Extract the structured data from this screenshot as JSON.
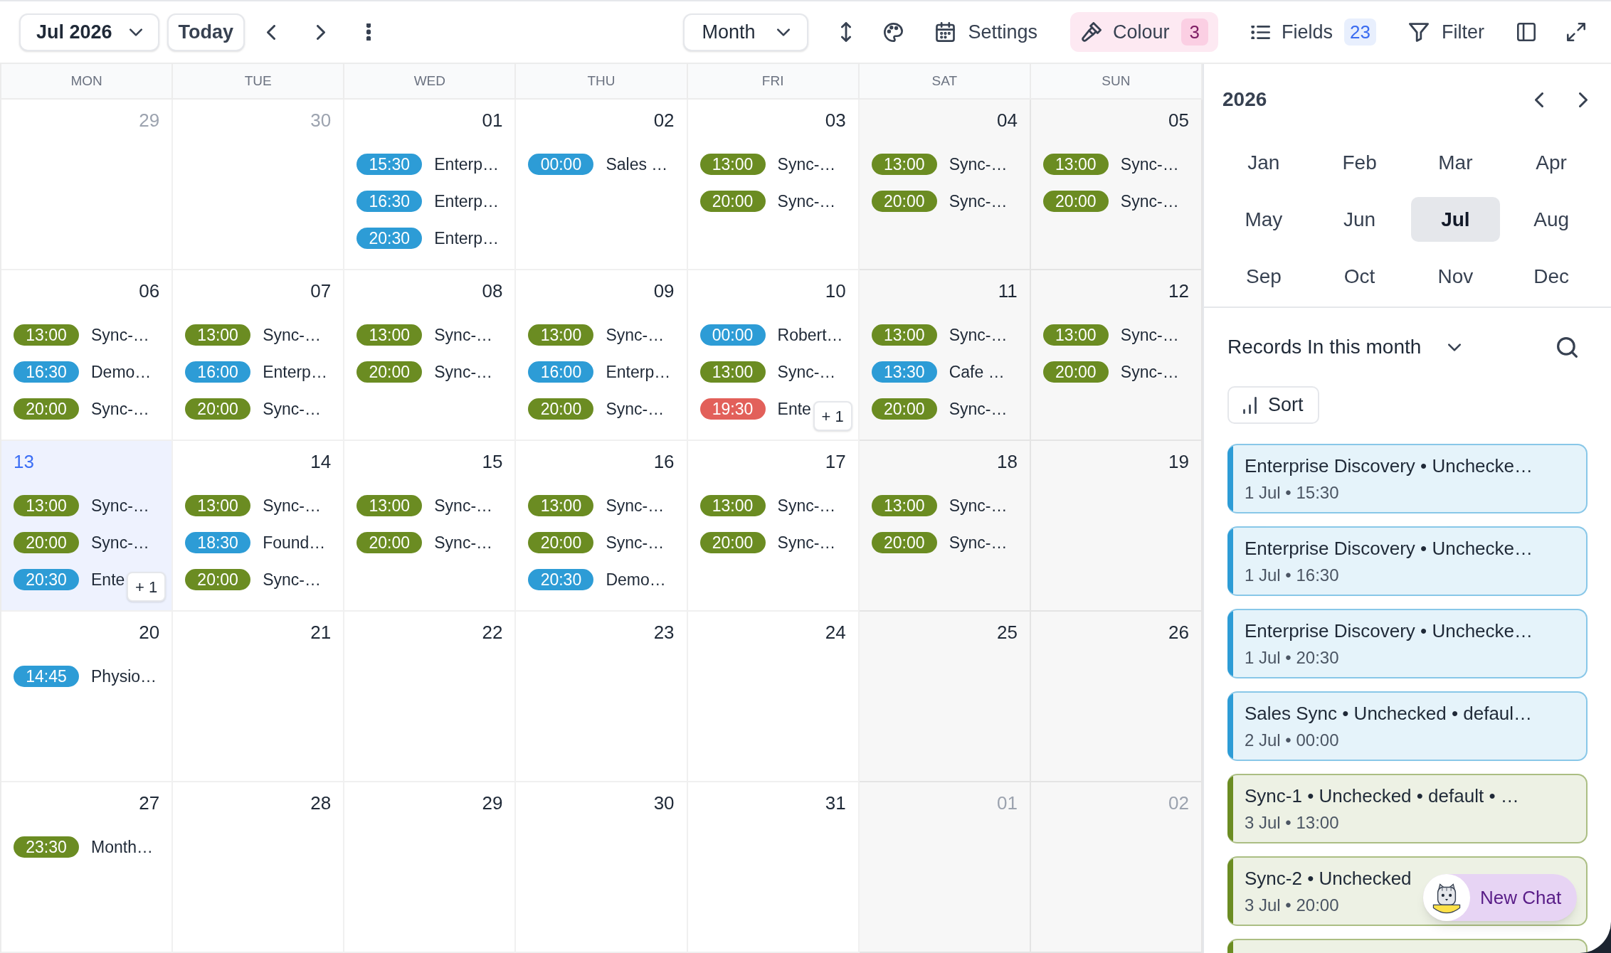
{
  "toolbar": {
    "period_picker": "Jul 2026",
    "today_button": "Today",
    "view_picker": "Month",
    "settings_button": "Settings",
    "colour_button": {
      "label": "Colour",
      "count": "3"
    },
    "fields_button": {
      "label": "Fields",
      "count": "23"
    },
    "filter_button": "Filter"
  },
  "calendar": {
    "weekdays": [
      {
        "label": "MON",
        "weekend": false
      },
      {
        "label": "TUE",
        "weekend": false
      },
      {
        "label": "WED",
        "weekend": false
      },
      {
        "label": "THU",
        "weekend": false
      },
      {
        "label": "FRI",
        "weekend": false
      },
      {
        "label": "SAT",
        "weekend": true
      },
      {
        "label": "SUN",
        "weekend": true
      }
    ],
    "weeks": [
      [
        {
          "day": "29",
          "outside_month": true,
          "today": false
        },
        {
          "day": "30",
          "outside_month": true,
          "today": false
        },
        {
          "day": "01",
          "outside_month": false,
          "today": false,
          "events": [
            {
              "time": "15:30",
              "title": "Enterp…",
              "color": "#2d9cd6"
            },
            {
              "time": "16:30",
              "title": "Enterp…",
              "color": "#2d9cd6"
            },
            {
              "time": "20:30",
              "title": "Enterp…",
              "color": "#2d9cd6"
            }
          ]
        },
        {
          "day": "02",
          "outside_month": false,
          "today": false,
          "events": [
            {
              "time": "00:00",
              "title": "Sales …",
              "color": "#2d9cd6"
            }
          ]
        },
        {
          "day": "03",
          "outside_month": false,
          "today": false,
          "events": [
            {
              "time": "13:00",
              "title": "Sync-…",
              "color": "#6b8c22"
            },
            {
              "time": "20:00",
              "title": "Sync-…",
              "color": "#6b8c22"
            }
          ]
        },
        {
          "day": "04",
          "outside_month": false,
          "today": false,
          "events": [
            {
              "time": "13:00",
              "title": "Sync-…",
              "color": "#6b8c22"
            },
            {
              "time": "20:00",
              "title": "Sync-…",
              "color": "#6b8c22"
            }
          ]
        },
        {
          "day": "05",
          "outside_month": false,
          "today": false,
          "events": [
            {
              "time": "13:00",
              "title": "Sync-…",
              "color": "#6b8c22"
            },
            {
              "time": "20:00",
              "title": "Sync-…",
              "color": "#6b8c22"
            }
          ]
        }
      ],
      [
        {
          "day": "06",
          "outside_month": false,
          "today": false,
          "events": [
            {
              "time": "13:00",
              "title": "Sync-…",
              "color": "#6b8c22"
            },
            {
              "time": "16:30",
              "title": "Demo…",
              "color": "#2d9cd6"
            },
            {
              "time": "20:00",
              "title": "Sync-…",
              "color": "#6b8c22"
            }
          ]
        },
        {
          "day": "07",
          "outside_month": false,
          "today": false,
          "events": [
            {
              "time": "13:00",
              "title": "Sync-…",
              "color": "#6b8c22"
            },
            {
              "time": "16:00",
              "title": "Enterp…",
              "color": "#2d9cd6"
            },
            {
              "time": "20:00",
              "title": "Sync-…",
              "color": "#6b8c22"
            }
          ]
        },
        {
          "day": "08",
          "outside_month": false,
          "today": false,
          "events": [
            {
              "time": "13:00",
              "title": "Sync-…",
              "color": "#6b8c22"
            },
            {
              "time": "20:00",
              "title": "Sync-…",
              "color": "#6b8c22"
            }
          ]
        },
        {
          "day": "09",
          "outside_month": false,
          "today": false,
          "events": [
            {
              "time": "13:00",
              "title": "Sync-…",
              "color": "#6b8c22"
            },
            {
              "time": "16:00",
              "title": "Enterp…",
              "color": "#2d9cd6"
            },
            {
              "time": "20:00",
              "title": "Sync-…",
              "color": "#6b8c22"
            }
          ]
        },
        {
          "day": "10",
          "outside_month": false,
          "today": false,
          "events": [
            {
              "time": "00:00",
              "title": "Robert…",
              "color": "#2d9cd6"
            },
            {
              "time": "13:00",
              "title": "Sync-…",
              "color": "#6b8c22"
            },
            {
              "time": "19:30",
              "title": "Ente",
              "color": "#e2605a"
            }
          ],
          "more": "+ 1"
        },
        {
          "day": "11",
          "outside_month": false,
          "today": false,
          "events": [
            {
              "time": "13:00",
              "title": "Sync-…",
              "color": "#6b8c22"
            },
            {
              "time": "13:30",
              "title": "Cafe …",
              "color": "#2d9cd6"
            },
            {
              "time": "20:00",
              "title": "Sync-…",
              "color": "#6b8c22"
            }
          ]
        },
        {
          "day": "12",
          "outside_month": false,
          "today": false,
          "events": [
            {
              "time": "13:00",
              "title": "Sync-…",
              "color": "#6b8c22"
            },
            {
              "time": "20:00",
              "title": "Sync-…",
              "color": "#6b8c22"
            }
          ]
        }
      ],
      [
        {
          "day": "13",
          "outside_month": false,
          "today": true,
          "events": [
            {
              "time": "13:00",
              "title": "Sync-…",
              "color": "#6b8c22"
            },
            {
              "time": "20:00",
              "title": "Sync-…",
              "color": "#6b8c22"
            },
            {
              "time": "20:30",
              "title": "Ente",
              "color": "#2d9cd6"
            }
          ],
          "more": "+ 1"
        },
        {
          "day": "14",
          "outside_month": false,
          "today": false,
          "events": [
            {
              "time": "13:00",
              "title": "Sync-…",
              "color": "#6b8c22"
            },
            {
              "time": "18:30",
              "title": "Found…",
              "color": "#2d9cd6"
            },
            {
              "time": "20:00",
              "title": "Sync-…",
              "color": "#6b8c22"
            }
          ]
        },
        {
          "day": "15",
          "outside_month": false,
          "today": false,
          "events": [
            {
              "time": "13:00",
              "title": "Sync-…",
              "color": "#6b8c22"
            },
            {
              "time": "20:00",
              "title": "Sync-…",
              "color": "#6b8c22"
            }
          ]
        },
        {
          "day": "16",
          "outside_month": false,
          "today": false,
          "events": [
            {
              "time": "13:00",
              "title": "Sync-…",
              "color": "#6b8c22"
            },
            {
              "time": "20:00",
              "title": "Sync-…",
              "color": "#6b8c22"
            },
            {
              "time": "20:30",
              "title": "Demo…",
              "color": "#2d9cd6"
            }
          ]
        },
        {
          "day": "17",
          "outside_month": false,
          "today": false,
          "events": [
            {
              "time": "13:00",
              "title": "Sync-…",
              "color": "#6b8c22"
            },
            {
              "time": "20:00",
              "title": "Sync-…",
              "color": "#6b8c22"
            }
          ]
        },
        {
          "day": "18",
          "outside_month": false,
          "today": false,
          "events": [
            {
              "time": "13:00",
              "title": "Sync-…",
              "color": "#6b8c22"
            },
            {
              "time": "20:00",
              "title": "Sync-…",
              "color": "#6b8c22"
            }
          ]
        },
        {
          "day": "19",
          "outside_month": false,
          "today": false
        }
      ],
      [
        {
          "day": "20",
          "outside_month": false,
          "today": false,
          "events": [
            {
              "time": "14:45",
              "title": "Physio…",
              "color": "#2d9cd6"
            }
          ]
        },
        {
          "day": "21",
          "outside_month": false,
          "today": false
        },
        {
          "day": "22",
          "outside_month": false,
          "today": false
        },
        {
          "day": "23",
          "outside_month": false,
          "today": false
        },
        {
          "day": "24",
          "outside_month": false,
          "today": false
        },
        {
          "day": "25",
          "outside_month": false,
          "today": false
        },
        {
          "day": "26",
          "outside_month": false,
          "today": false
        }
      ],
      [
        {
          "day": "27",
          "outside_month": false,
          "today": false,
          "events": [
            {
              "time": "23:30",
              "title": "Month…",
              "color": "#6b8c22"
            }
          ]
        },
        {
          "day": "28",
          "outside_month": false,
          "today": false
        },
        {
          "day": "29",
          "outside_month": false,
          "today": false
        },
        {
          "day": "30",
          "outside_month": false,
          "today": false
        },
        {
          "day": "31",
          "outside_month": false,
          "today": false
        },
        {
          "day": "01",
          "outside_month": true,
          "today": false
        },
        {
          "day": "02",
          "outside_month": true,
          "today": false
        }
      ]
    ]
  },
  "year_panel": {
    "year": "2026",
    "months": [
      {
        "label": "Jan",
        "selected": false
      },
      {
        "label": "Feb",
        "selected": false
      },
      {
        "label": "Mar",
        "selected": false
      },
      {
        "label": "Apr",
        "selected": false
      },
      {
        "label": "May",
        "selected": false
      },
      {
        "label": "Jun",
        "selected": false
      },
      {
        "label": "Jul",
        "selected": true
      },
      {
        "label": "Aug",
        "selected": false
      },
      {
        "label": "Sep",
        "selected": false
      },
      {
        "label": "Oct",
        "selected": false
      },
      {
        "label": "Nov",
        "selected": false
      },
      {
        "label": "Dec",
        "selected": false
      }
    ]
  },
  "records": {
    "heading": "Records In this month",
    "sort_button": "Sort",
    "items": [
      {
        "title": "Enterprise Discovery • Unchecke…",
        "subtitle": "1 Jul • 15:30",
        "color": "#2d9cd6"
      },
      {
        "title": "Enterprise Discovery • Unchecke…",
        "subtitle": "1 Jul • 16:30",
        "color": "#2d9cd6"
      },
      {
        "title": "Enterprise Discovery • Unchecke…",
        "subtitle": "1 Jul • 20:30",
        "color": "#2d9cd6"
      },
      {
        "title": "Sales Sync • Unchecked • defaul…",
        "subtitle": "2 Jul • 00:00",
        "color": "#2d9cd6"
      },
      {
        "title": "Sync-1 • Unchecked • default • …",
        "subtitle": "3 Jul • 13:00",
        "color": "#6b8c22"
      },
      {
        "title": "Sync-2 • Unchecked",
        "subtitle": "3 Jul • 20:00",
        "color": "#6b8c22"
      },
      {
        "color": "#6b8c22"
      }
    ]
  },
  "chat_button": "New Chat"
}
